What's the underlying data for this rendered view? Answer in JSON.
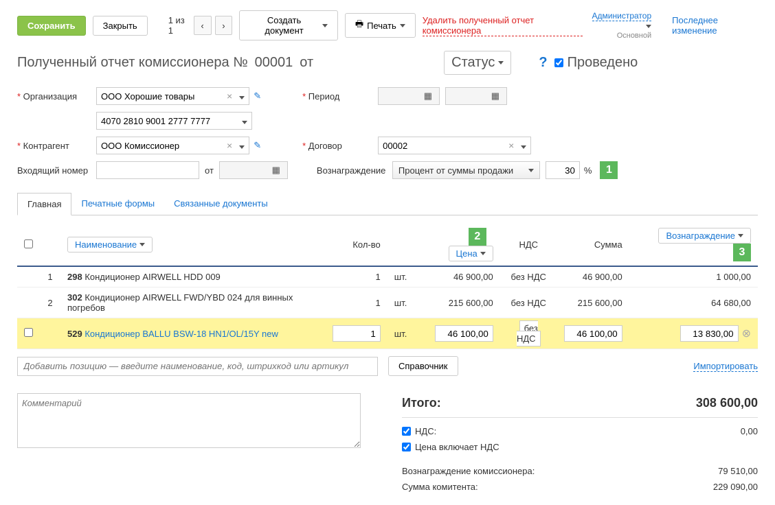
{
  "toolbar": {
    "save": "Сохранить",
    "close": "Закрыть",
    "pager": "1 из 1",
    "create_doc": "Создать документ",
    "print": "Печать",
    "delete_link": "Удалить полученный отчет комиссионера",
    "admin": "Администратор",
    "admin_sub": "Основной",
    "last_change": "Последнее изменение"
  },
  "title": {
    "text": "Полученный отчет комиссионера №",
    "num": "00001",
    "ot": "от",
    "status": "Статус",
    "posted": "Проведено"
  },
  "form": {
    "org_label": "Организация",
    "org_value": "ООО Хорошие товары",
    "org_acct": "4070 2810 9001 2777 7777",
    "period_label": "Период",
    "contr_label": "Контрагент",
    "contr_value": "ООО Комиссионер",
    "contract_label": "Договор",
    "contract_value": "00002",
    "incoming_label": "Входящий номер",
    "ot": "от",
    "reward_label": "Вознаграждение",
    "reward_type": "Процент от суммы продажи",
    "reward_pct": "30",
    "pct_sign": "%"
  },
  "tabs": {
    "main": "Главная",
    "print_forms": "Печатные формы",
    "linked_docs": "Связанные документы"
  },
  "grid": {
    "headers": {
      "name": "Наименование",
      "qty": "Кол-во",
      "price": "Цена",
      "vat": "НДС",
      "sum": "Сумма",
      "reward": "Вознаграждение"
    },
    "rows": [
      {
        "n": "1",
        "code": "298",
        "name": "Кондиционер AIRWELL HDD 009",
        "qty": "1",
        "unit": "шт.",
        "price": "46 900,00",
        "vat": "без НДС",
        "sum": "46 900,00",
        "reward": "1 000,00",
        "selected": false,
        "link": false
      },
      {
        "n": "2",
        "code": "302",
        "name": "Кондиционер AIRWELL FWD/YBD 024 для винных погребов",
        "qty": "1",
        "unit": "шт.",
        "price": "215 600,00",
        "vat": "без НДС",
        "sum": "215 600,00",
        "reward": "64 680,00",
        "selected": false,
        "link": false
      },
      {
        "n": "",
        "code": "529",
        "name": "Кондиционер BALLU BSW-18 HN1/OL/15Y new",
        "qty": "1",
        "unit": "шт.",
        "price": "46 100,00",
        "vat": "без НДС",
        "sum": "46 100,00",
        "reward": "13 830,00",
        "selected": true,
        "link": true
      }
    ],
    "add_placeholder": "Добавить позицию — введите наименование, код, штрихкод или артикул",
    "reference": "Справочник",
    "import": "Импортировать"
  },
  "totals": {
    "total_label": "Итого:",
    "total_value": "308 600,00",
    "vat_label": "НДС:",
    "vat_value": "0,00",
    "price_incl_vat": "Цена включает НДС",
    "commission_label": "Вознаграждение комиссионера:",
    "commission_value": "79 510,00",
    "comitent_label": "Сумма комитента:",
    "comitent_value": "229 090,00"
  },
  "comment_placeholder": "Комментарий",
  "badges": {
    "b1": "1",
    "b2": "2",
    "b3": "3"
  }
}
